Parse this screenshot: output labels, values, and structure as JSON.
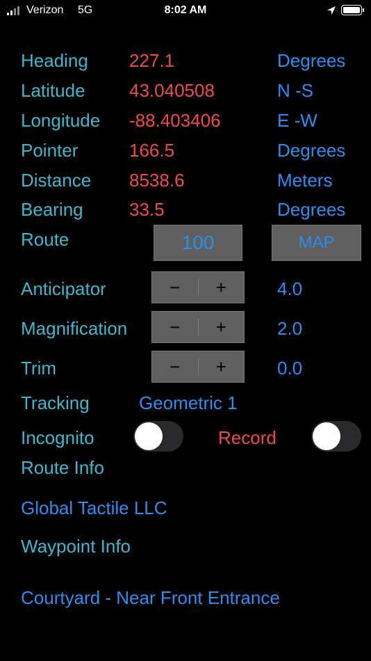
{
  "status_bar": {
    "carrier": "Verizon",
    "network": "5G",
    "time": "8:02 AM"
  },
  "rows": [
    {
      "label": "Heading",
      "value": "227.1",
      "unit": "Degrees"
    },
    {
      "label": "Latitude",
      "value": "43.040508",
      "unit": "N -S"
    },
    {
      "label": "Longitude",
      "value": "-88.403406",
      "unit": "E -W"
    },
    {
      "label": "Pointer",
      "value": "166.5",
      "unit": "Degrees"
    },
    {
      "label": "Distance",
      "value": "8538.6",
      "unit": "Meters"
    },
    {
      "label": "Bearing",
      "value": "33.5",
      "unit": "Degrees"
    }
  ],
  "route": {
    "label": "Route",
    "value": "100",
    "map_button": "MAP"
  },
  "steppers": [
    {
      "label": "Anticipator",
      "value": "4.0"
    },
    {
      "label": "Magnification",
      "value": "2.0"
    },
    {
      "label": "Trim",
      "value": "0.0"
    }
  ],
  "stepper_symbols": {
    "minus": "−",
    "plus": "+"
  },
  "tracking": {
    "label": "Tracking",
    "value": "Geometric 1"
  },
  "incognito": {
    "label": "Incognito",
    "on": false
  },
  "record": {
    "label": "Record",
    "on": false
  },
  "route_info": {
    "label": "Route Info",
    "text": "Global Tactile LLC"
  },
  "waypoint_info": {
    "label": "Waypoint Info",
    "text": "Courtyard - Near Front Entrance"
  },
  "colors": {
    "label": "#3db8d0",
    "value": "#f04a45",
    "link": "#2b8ef0",
    "button_bg": "#5f5f5f"
  }
}
